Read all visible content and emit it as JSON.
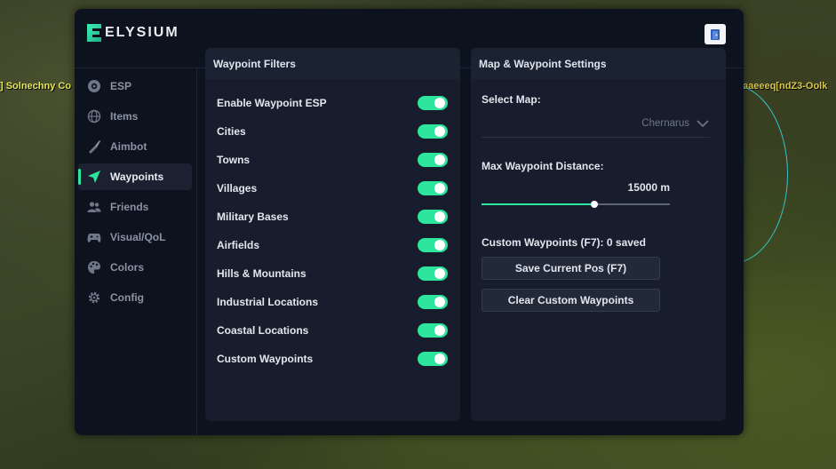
{
  "background": {
    "left_label": "] Solnechny Co",
    "right_label": "aaeeeq[ndZ3-Oolk"
  },
  "app": {
    "logo_text": "ELYSIUM",
    "accent_color": "#2ee59d"
  },
  "sidebar": {
    "items": [
      {
        "label": "ESP",
        "icon": "eye-icon",
        "active": false
      },
      {
        "label": "Items",
        "icon": "globe-icon",
        "active": false
      },
      {
        "label": "Aimbot",
        "icon": "crosshair-knife-icon",
        "active": false
      },
      {
        "label": "Waypoints",
        "icon": "navigation-arrow-icon",
        "active": true
      },
      {
        "label": "Friends",
        "icon": "users-icon",
        "active": false
      },
      {
        "label": "Visual/QoL",
        "icon": "gamepad-icon",
        "active": false
      },
      {
        "label": "Colors",
        "icon": "palette-icon",
        "active": false
      },
      {
        "label": "Config",
        "icon": "gear-icon",
        "active": false
      }
    ]
  },
  "filters": {
    "title": "Waypoint Filters",
    "items": [
      {
        "label": "Enable Waypoint ESP",
        "enabled": true
      },
      {
        "label": "Cities",
        "enabled": true
      },
      {
        "label": "Towns",
        "enabled": true
      },
      {
        "label": "Villages",
        "enabled": true
      },
      {
        "label": "Military Bases",
        "enabled": true
      },
      {
        "label": "Airfields",
        "enabled": true
      },
      {
        "label": "Hills & Mountains",
        "enabled": true
      },
      {
        "label": "Industrial Locations",
        "enabled": true
      },
      {
        "label": "Coastal Locations",
        "enabled": true
      },
      {
        "label": "Custom Waypoints",
        "enabled": true
      }
    ]
  },
  "settings": {
    "title": "Map & Waypoint Settings",
    "select_map_label": "Select Map:",
    "selected_map": "Chernarus",
    "distance_label": "Max Waypoint Distance:",
    "distance_value": "15000 m",
    "distance_fraction": 0.6,
    "custom_waypoints_label": "Custom Waypoints (F7): 0 saved",
    "save_button": "Save Current Pos (F7)",
    "clear_button": "Clear Custom Waypoints"
  }
}
